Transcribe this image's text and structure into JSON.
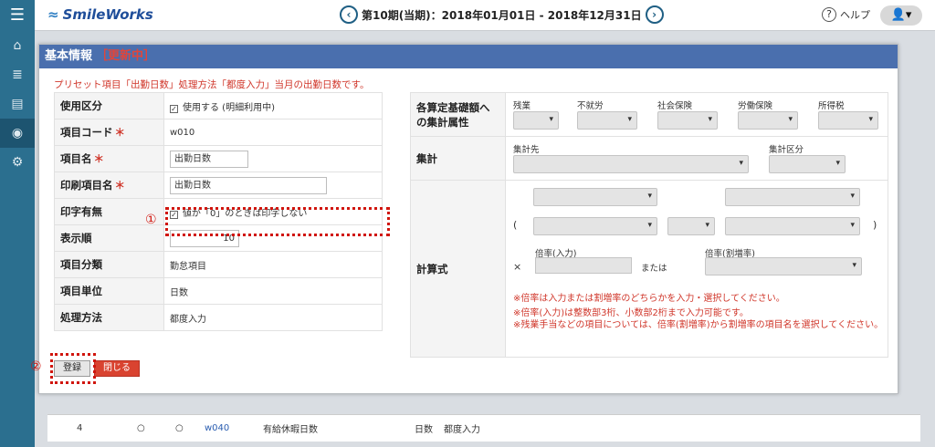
{
  "topbar": {
    "menu_icon": "hamburger-icon",
    "logo": "SmileWorks",
    "period": "第10期(当期)：2018年01月01日 - 2018年12月31日",
    "prev_icon": "chevron-left-icon",
    "next_icon": "chevron-right-icon",
    "help": "ヘルプ",
    "user_icon": "user-icon"
  },
  "sidebar": {
    "icons": [
      "home-icon",
      "list-icon",
      "document-icon",
      "money-icon",
      "gear-icon"
    ]
  },
  "background_row": {
    "num": "4",
    "c1": "○",
    "c2": "○",
    "code": "w040",
    "name": "有給休暇日数",
    "unit": "日数",
    "method": "都度入力"
  },
  "modal": {
    "title": "基本情報",
    "status": "［更新中］",
    "notice": "プリセット項目「出勤日数」処理方法「都度入力」当月の出勤日数です。",
    "rows": [
      {
        "label": "使用区分",
        "value": "使用する (明細利用中)"
      },
      {
        "label": "項目コード",
        "value": "w010"
      },
      {
        "label": "項目名",
        "value": "出勤日数"
      },
      {
        "label": "印刷項目名",
        "value": "出勤日数"
      },
      {
        "label": "印字有無",
        "value": "値が「0」のときは印字しない"
      },
      {
        "label": "表示順",
        "value": "10"
      },
      {
        "label": "項目分類",
        "value": "勤怠項目"
      },
      {
        "label": "項目単位",
        "value": "日数"
      },
      {
        "label": "処理方法",
        "value": "都度入力"
      }
    ],
    "required_mark": "＊",
    "right": {
      "attr_label": "各算定基礎額への集計属性",
      "attrs": [
        "残業",
        "不就労",
        "社会保険",
        "労働保険",
        "所得税"
      ],
      "sum_label": "集計",
      "sum_dest": "集計先",
      "sum_class": "集計区分",
      "formula_label": "計算式",
      "open_paren": "(",
      "close_paren": ")",
      "times": "×",
      "rate_input": "倍率(入力)",
      "or": "または",
      "rate_mult": "倍率(割増率)",
      "notes": [
        "※倍率は入力または割増率のどちらかを入力・選択してください。",
        "※倍率(入力)は整数部3桁、小数部2桁まで入力可能です。",
        "※残業手当などの項目については、倍率(割増率)から割増率の項目名を選択してください。"
      ]
    },
    "buttons": {
      "register": "登録",
      "close": "閉じる"
    },
    "markers": {
      "one": "①",
      "two": "②"
    }
  }
}
